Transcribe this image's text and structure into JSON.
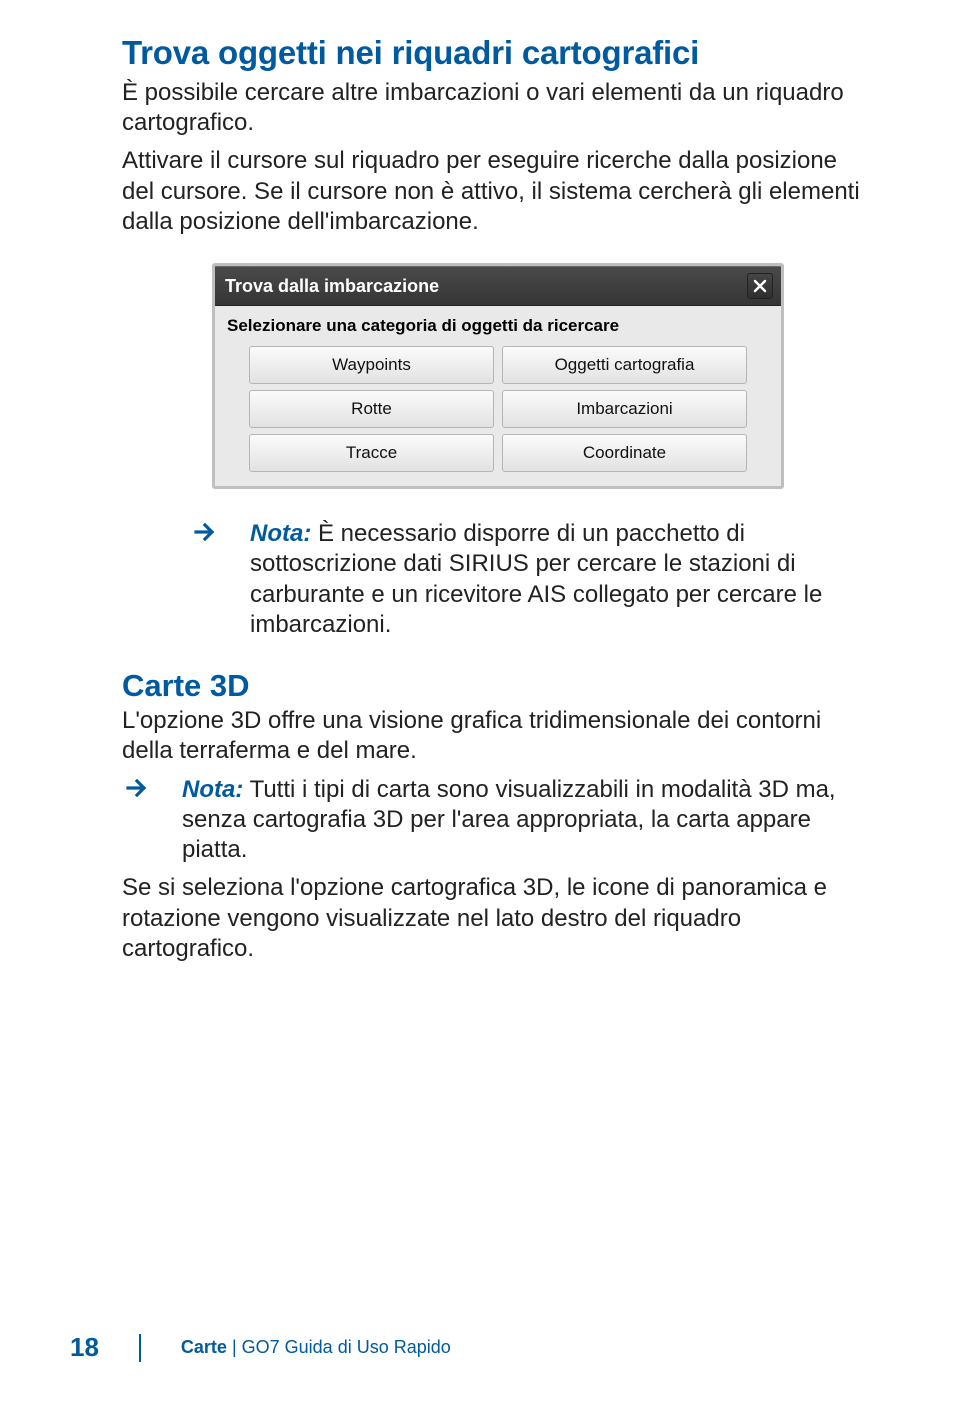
{
  "section1": {
    "heading": "Trova oggetti nei riquadri cartografici",
    "para1": "È possibile cercare altre imbarcazioni o vari elementi da un riquadro cartografico.",
    "para2": "Attivare il cursore sul riquadro per eseguire ricerche dalla posizione del cursore. Se il cursore non è attivo, il sistema cercherà gli elementi dalla posizione dell'imbarcazione."
  },
  "dialog": {
    "title": "Trova dalla imbarcazione",
    "prompt": "Selezionare una categoria di oggetti da ricercare",
    "buttons": {
      "waypoints": "Waypoints",
      "chartObjects": "Oggetti cartografia",
      "routes": "Rotte",
      "vessels": "Imbarcazioni",
      "tracks": "Tracce",
      "coordinates": "Coordinate"
    }
  },
  "note1": {
    "label": "Nota:",
    "text": " È necessario disporre di un pacchetto di sottoscrizione dati SIRIUS per cercare le stazioni di carburante e un ricevitore AIS collegato per cercare le imbarcazioni."
  },
  "section2": {
    "heading": "Carte 3D",
    "para1": "L'opzione 3D offre una visione grafica tridimensionale dei contorni della terraferma e del mare.",
    "note2": {
      "label": "Nota:",
      "text": " Tutti i tipi di carta sono visualizzabili in modalità 3D ma, senza cartografia 3D per l'area appropriata, la carta appare piatta."
    },
    "para2": "Se si seleziona l'opzione cartografica 3D, le icone di panoramica e rotazione vengono visualizzate nel lato destro del riquadro cartografico."
  },
  "footer": {
    "pageNumber": "18",
    "chapter": "Carte",
    "separator": " | ",
    "docTitle": "GO7 Guida di Uso Rapido"
  }
}
